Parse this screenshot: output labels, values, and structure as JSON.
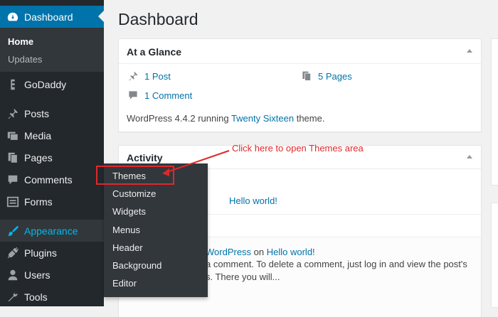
{
  "sidebar": {
    "items": [
      {
        "label": "Dashboard",
        "icon": "dashboard-icon"
      },
      {
        "label": "GoDaddy",
        "icon": "godaddy-icon"
      },
      {
        "label": "Posts",
        "icon": "pin-icon"
      },
      {
        "label": "Media",
        "icon": "media-icon"
      },
      {
        "label": "Pages",
        "icon": "pages-icon"
      },
      {
        "label": "Comments",
        "icon": "comment-icon"
      },
      {
        "label": "Forms",
        "icon": "forms-icon"
      },
      {
        "label": "Appearance",
        "icon": "paintbrush-icon"
      },
      {
        "label": "Plugins",
        "icon": "plugin-icon"
      },
      {
        "label": "Users",
        "icon": "users-icon"
      },
      {
        "label": "Tools",
        "icon": "wrench-icon"
      }
    ],
    "dashboard_sub": [
      "Home",
      "Updates"
    ]
  },
  "flyout": [
    "Themes",
    "Customize",
    "Widgets",
    "Menus",
    "Header",
    "Background",
    "Editor"
  ],
  "page_title": "Dashboard",
  "glance": {
    "title": "At a Glance",
    "posts": "1 Post",
    "pages": "5 Pages",
    "comments": "1 Comment",
    "version_prefix": "WordPress 4.4.2 running ",
    "theme": "Twenty Sixteen",
    "version_suffix": " theme."
  },
  "activity": {
    "title": "Activity",
    "recent_link": "Hello world!",
    "comment_author_link": "WordPress",
    "comment_on": " on ",
    "comment_post_link": "Hello world!",
    "comment_line2": "a comment. To delete a comment, just log in and view the post's",
    "comment_line3": "s. There you will..."
  },
  "annotation": "Click here to open Themes area",
  "colors": {
    "accent": "#0073aa",
    "sidebar": "#23282d",
    "annotation": "#e0282a"
  }
}
